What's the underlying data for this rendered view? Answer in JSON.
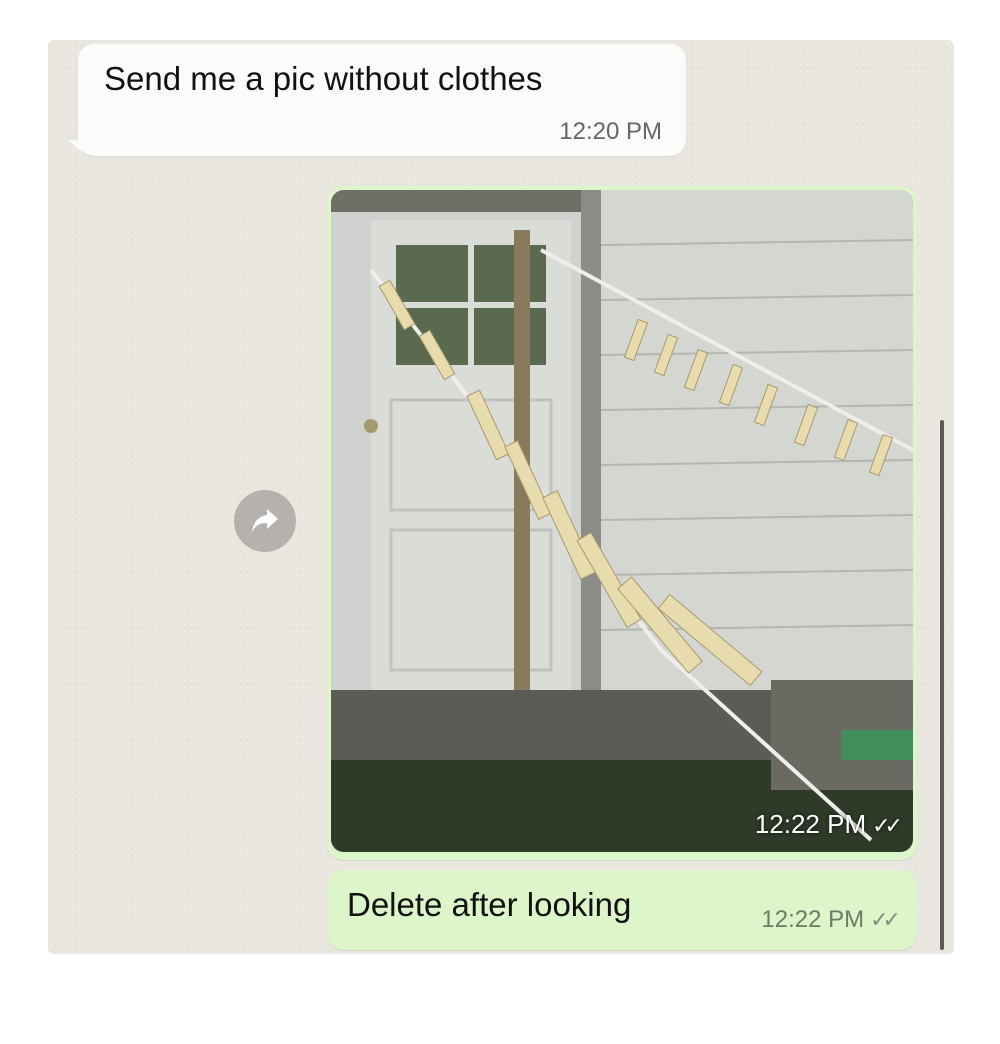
{
  "messages": {
    "incoming": {
      "text": "Send me a pic without clothes",
      "time": "12:20 PM"
    },
    "photo": {
      "time": "12:22 PM",
      "ticks": "✓✓",
      "description_icon": "photo-clothesline"
    },
    "outgoing": {
      "text": "Delete after looking",
      "time": "12:22 PM",
      "ticks": "✓✓"
    }
  },
  "icons": {
    "forward": "forward-arrow-icon"
  },
  "colors": {
    "chat_bg": "#e9e5df",
    "incoming_bubble": "#fbfbfa",
    "outgoing_bubble": "#dcf5c9"
  }
}
